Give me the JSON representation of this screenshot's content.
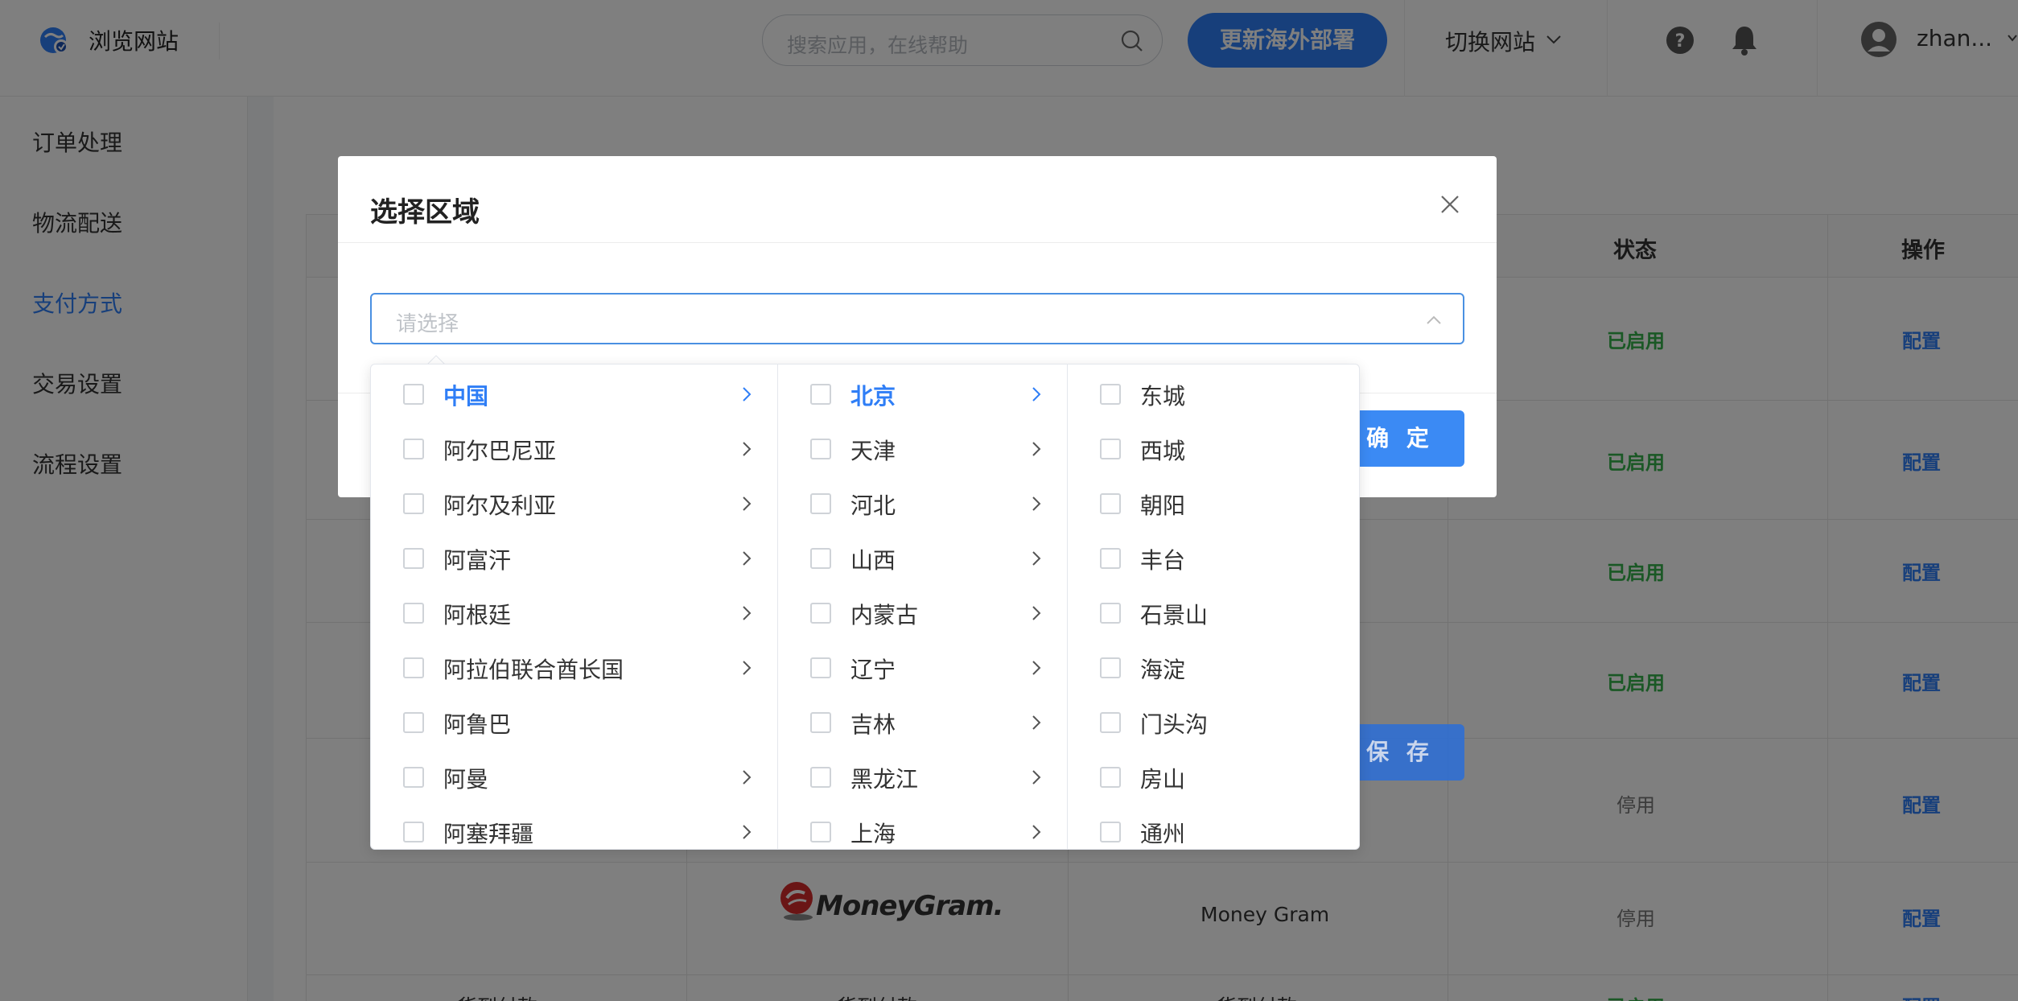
{
  "header": {
    "brand": "浏览网站",
    "search_placeholder": "搜索应用，在线帮助",
    "deploy_button": "更新海外部署",
    "switch_site": "切换网站",
    "username": "zhan..."
  },
  "sidebar": {
    "items": [
      {
        "label": "订单处理",
        "active": false
      },
      {
        "label": "物流配送",
        "active": false
      },
      {
        "label": "支付方式",
        "active": true
      },
      {
        "label": "交易设置",
        "active": false
      },
      {
        "label": "流程设置",
        "active": false
      }
    ]
  },
  "table": {
    "headers": {
      "status": "状态",
      "action": "操作"
    },
    "rows": [
      {
        "status": "已启用",
        "action": "配置"
      },
      {
        "status": "已启用",
        "action": "配置"
      },
      {
        "status": "已启用",
        "action": "配置"
      },
      {
        "status": "已启用",
        "action": "配置"
      },
      {
        "status": "停用",
        "action": "配置"
      },
      {
        "name": "Money Gram",
        "logo": "MoneyGram.",
        "status": "停用",
        "action": "配置"
      },
      {
        "type": "货到付款",
        "method": "货到付款",
        "name": "货到付款",
        "status": "已启用",
        "action": "配置"
      }
    ],
    "save_button": "保 存"
  },
  "dialog": {
    "title": "选择区域",
    "select_placeholder": "请选择",
    "ok_button": "确 定"
  },
  "cascader": {
    "countries": [
      {
        "label": "中国",
        "has_children": true,
        "active": true
      },
      {
        "label": "阿尔巴尼亚",
        "has_children": true
      },
      {
        "label": "阿尔及利亚",
        "has_children": true
      },
      {
        "label": "阿富汗",
        "has_children": true
      },
      {
        "label": "阿根廷",
        "has_children": true
      },
      {
        "label": "阿拉伯联合酋长国",
        "has_children": true
      },
      {
        "label": "阿鲁巴",
        "has_children": false
      },
      {
        "label": "阿曼",
        "has_children": true
      },
      {
        "label": "阿塞拜疆",
        "has_children": true
      }
    ],
    "provinces": [
      {
        "label": "北京",
        "has_children": true,
        "active": true
      },
      {
        "label": "天津",
        "has_children": true
      },
      {
        "label": "河北",
        "has_children": true
      },
      {
        "label": "山西",
        "has_children": true
      },
      {
        "label": "内蒙古",
        "has_children": true
      },
      {
        "label": "辽宁",
        "has_children": true
      },
      {
        "label": "吉林",
        "has_children": true
      },
      {
        "label": "黑龙江",
        "has_children": true
      },
      {
        "label": "上海",
        "has_children": true
      }
    ],
    "districts": [
      {
        "label": "东城"
      },
      {
        "label": "西城"
      },
      {
        "label": "朝阳"
      },
      {
        "label": "丰台"
      },
      {
        "label": "石景山"
      },
      {
        "label": "海淀"
      },
      {
        "label": "门头沟"
      },
      {
        "label": "房山"
      },
      {
        "label": "通州"
      }
    ]
  },
  "colors": {
    "accent": "#2f7ef6",
    "enabled": "#35b04a",
    "disabled": "#777777"
  }
}
